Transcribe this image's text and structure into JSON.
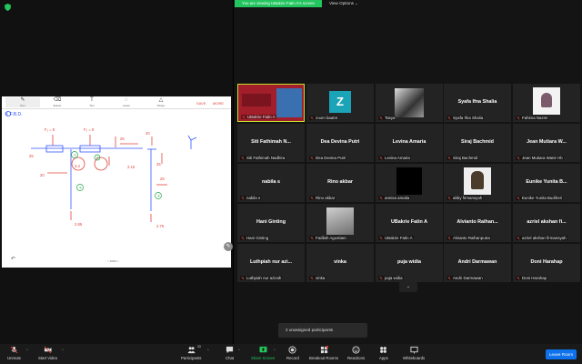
{
  "share": {
    "banner": "You are viewing UBakrie Fatin A's screen",
    "view_options": "View Options",
    "caret": "⌄"
  },
  "whiteboard": {
    "tools": [
      {
        "label": "Pen",
        "icon": "pen-icon"
      },
      {
        "label": "Eraser",
        "icon": "eraser-icon"
      },
      {
        "label": "Text",
        "icon": "text-icon"
      },
      {
        "label": "Lasso",
        "icon": "lasso-icon"
      },
      {
        "label": "Shape",
        "icon": "shape-icon"
      }
    ],
    "save": "SAVE",
    "more": "MORE",
    "zoom": "< 100% >",
    "heading": "① F.B.D.",
    "labels": [
      "F₁ = 8",
      "F₂ = 8",
      "25",
      "25",
      "25",
      "25",
      "20",
      "2.85",
      "2.15",
      "3.4",
      "20",
      "2.75",
      "① ",
      "②",
      "③",
      "④"
    ]
  },
  "tiles": [
    {
      "big": "",
      "label": "UBakrie Fatin A",
      "type": "image",
      "highlight": true
    },
    {
      "big": "Z",
      "label": "zoom baa04",
      "type": "avatar"
    },
    {
      "big": "",
      "label": "Tasya",
      "type": "photo-bw"
    },
    {
      "big": "Syafa Ifna Shalia",
      "label": "Syafa Ifna Shalia",
      "type": "name"
    },
    {
      "big": "",
      "label": "Fahima Nazmi",
      "type": "photo-white"
    },
    {
      "big": "Siti Fathimah N...",
      "label": "Siti Fathimah Nadhira",
      "type": "name"
    },
    {
      "big": "Dea Devina Putri",
      "label": "Dea Devina Putri",
      "type": "name"
    },
    {
      "big": "Levina Amaria",
      "label": "Levina Amaria",
      "type": "name"
    },
    {
      "big": "Siraj Bachmid",
      "label": "Siraj Bachmid",
      "type": "name"
    },
    {
      "big": "Jean Mutiara W...",
      "label": "Jean Mutiara Wanir Hb",
      "type": "name"
    },
    {
      "big": "nabila s",
      "label": "nabila s",
      "type": "name"
    },
    {
      "big": "Rino akbar",
      "label": "Rino akbar",
      "type": "name"
    },
    {
      "big": "",
      "label": "annisa amalia",
      "type": "black"
    },
    {
      "big": "",
      "label": "abby firmansyah",
      "type": "photo-person"
    },
    {
      "big": "Eunike Yunita B...",
      "label": "Eunike Yunita Budiheri",
      "type": "name"
    },
    {
      "big": "Hani Ginting",
      "label": "Hani Ginting",
      "type": "name"
    },
    {
      "big": "",
      "label": "Fadilah Agustiani",
      "type": "photo-gray"
    },
    {
      "big": "UBakrie Fatin A",
      "label": "UBakrie Fatin A",
      "type": "name"
    },
    {
      "big": "Alvianto Raihan...",
      "label": "Alvianto Raihanputra",
      "type": "name"
    },
    {
      "big": "azriel akshan fi...",
      "label": "azriel akshan firmansyah",
      "type": "name"
    },
    {
      "big": "Luthpiah nur azi...",
      "label": "Luthpiah nur azizah",
      "type": "name"
    },
    {
      "big": "vinka",
      "label": "vinka",
      "type": "name"
    },
    {
      "big": "puja widia",
      "label": "puja widia",
      "type": "name"
    },
    {
      "big": "Andri Darmawan",
      "label": "Andri Darmawan",
      "type": "name"
    },
    {
      "big": "Doni Harahap",
      "label": "Doni Harahap",
      "type": "name"
    }
  ],
  "gallery": {
    "unassigned": "2 unassigned participants",
    "chevron": "⌄"
  },
  "toolbar": {
    "unmute": "Unmute",
    "start_video": "Start Video",
    "participants": "Participants",
    "participants_count": "33",
    "chat": "Chat",
    "share_screen": "Share Screen",
    "record": "Record",
    "breakout": "Breakout Rooms",
    "reactions": "Reactions",
    "apps": "Apps",
    "whiteboards": "Whiteboards",
    "leave": "Leave Room",
    "caret": "^"
  },
  "colors": {
    "accent": "#0e72ed",
    "green": "#22c55e",
    "speaker_border": "#c7e12e",
    "mic_muted": "#e0443a"
  }
}
